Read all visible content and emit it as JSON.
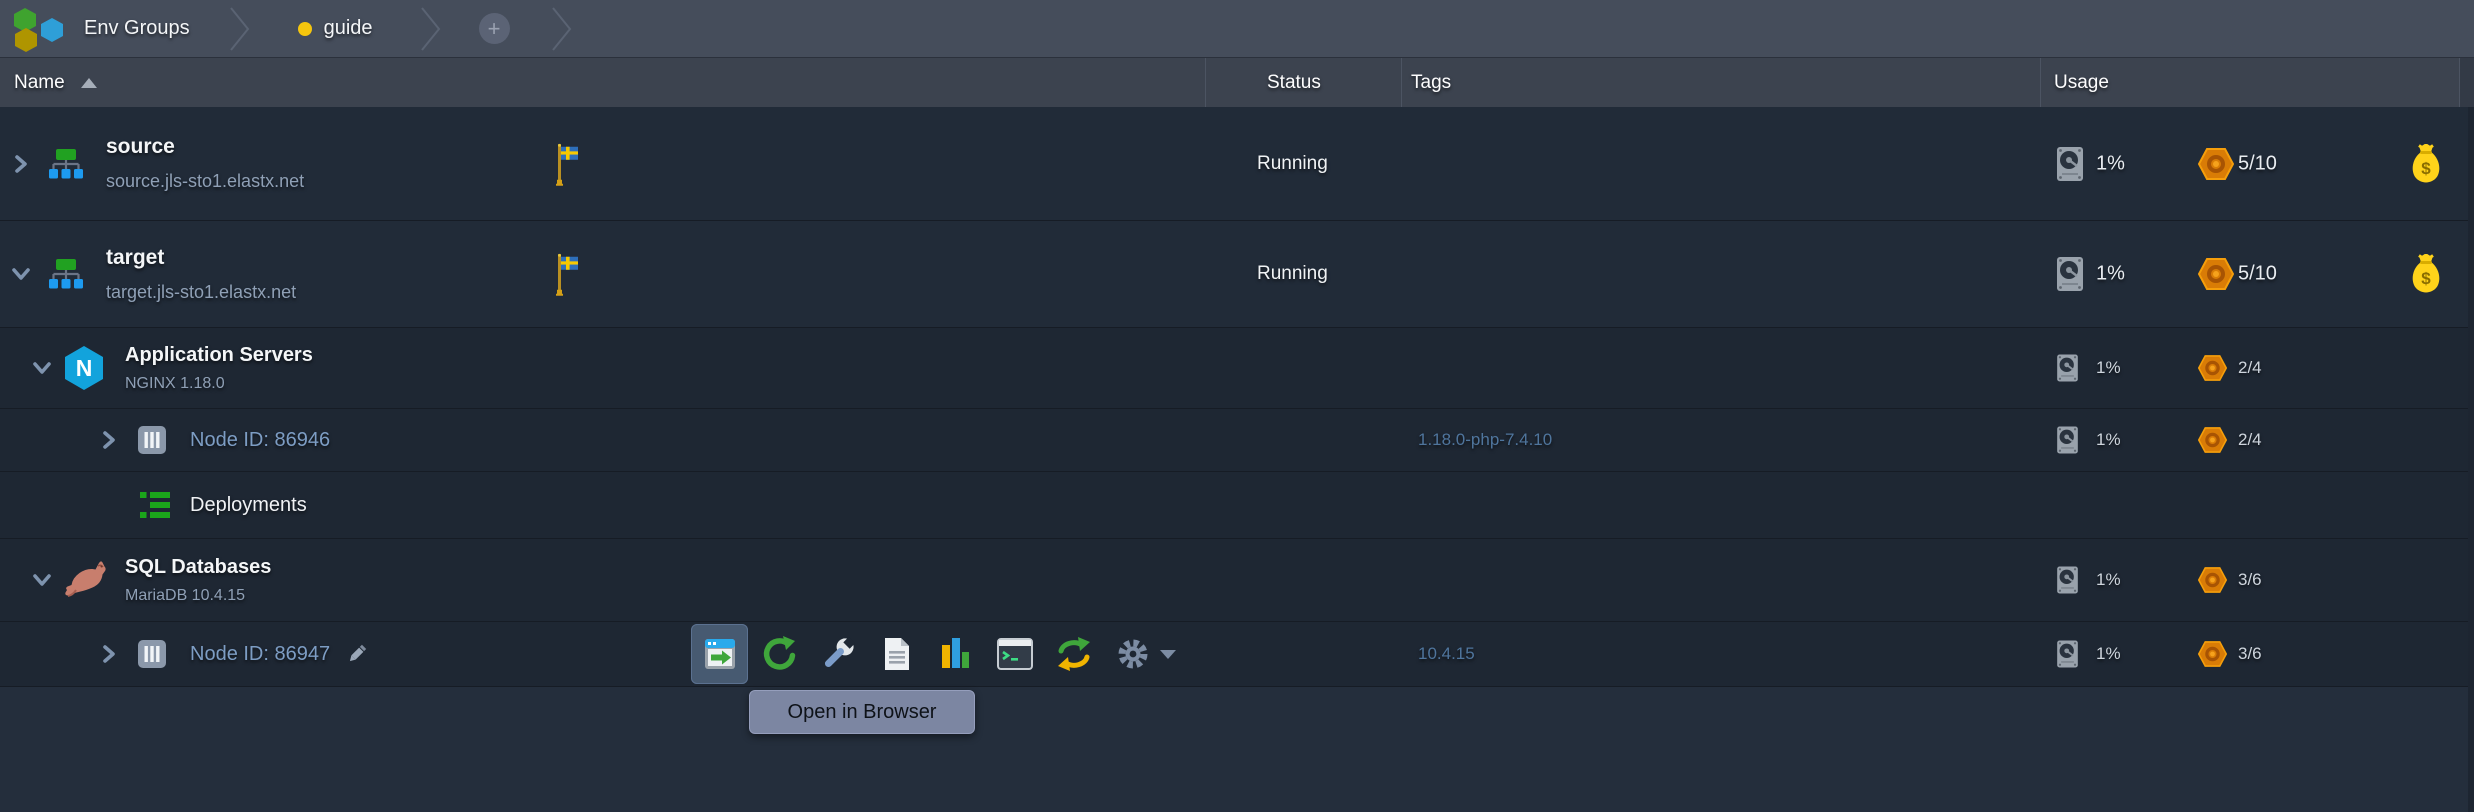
{
  "breadcrumb": {
    "items": [
      {
        "label": "Env Groups"
      },
      {
        "label": "guide",
        "dot_color": "#f5c60e"
      }
    ],
    "add_button_label": "+"
  },
  "table": {
    "columns": {
      "name": "Name",
      "status": "Status",
      "tags": "Tags",
      "usage": "Usage"
    },
    "sort": {
      "column": "Name",
      "direction": "asc"
    },
    "rows": [
      {
        "type": "environment",
        "expanded": false,
        "name": "source",
        "domain": "source.jls-sto1.elastx.net",
        "region_icon": "sweden-flag",
        "status": "Running",
        "disk": "1%",
        "cloudlets": "5/10",
        "billing_icon": "money-bag"
      },
      {
        "type": "environment",
        "expanded": true,
        "name": "target",
        "domain": "target.jls-sto1.elastx.net",
        "region_icon": "sweden-flag",
        "status": "Running",
        "disk": "1%",
        "cloudlets": "5/10",
        "billing_icon": "money-bag"
      },
      {
        "type": "node-group",
        "expanded": true,
        "name": "Application Servers",
        "stack": "NGINX 1.18.0",
        "stack_icon": "nginx",
        "disk": "1%",
        "cloudlets": "2/4"
      },
      {
        "type": "node",
        "name": "Node ID: 86946",
        "tag": "1.18.0-php-7.4.10",
        "disk": "1%",
        "cloudlets": "2/4"
      },
      {
        "type": "deployments",
        "name": "Deployments"
      },
      {
        "type": "node-group",
        "expanded": true,
        "name": "SQL Databases",
        "stack": "MariaDB 10.4.15",
        "stack_icon": "mariadb",
        "disk": "1%",
        "cloudlets": "3/6"
      },
      {
        "type": "node",
        "name": "Node ID: 86947",
        "editable": true,
        "tag": "10.4.15",
        "disk": "1%",
        "cloudlets": "3/6"
      }
    ]
  },
  "toolbar": {
    "icons": [
      "open-in-browser",
      "restart-node",
      "config",
      "log",
      "statistics",
      "web-ssh",
      "redeploy",
      "settings"
    ],
    "active_icon": "open-in-browser",
    "tooltip": "Open in Browser"
  },
  "glyphs": {
    "nginx_letter": "N",
    "money_symbol": "$"
  },
  "colors": {
    "topbar_bg": "#454d5b",
    "header_bg": "#3c434f",
    "row_env_bg": "#212b38",
    "row_nested_bg": "#1e2733",
    "below_table_bg": "#242e3c",
    "accent_blue": "#2f9fe0",
    "accent_green": "#3fa63b",
    "accent_orange": "#ef8f07",
    "accent_yellow": "#f5c60e",
    "tag_text": "#4f759d",
    "node_text": "#7d9dc4",
    "tooltip_bg": "#7c86a2"
  }
}
